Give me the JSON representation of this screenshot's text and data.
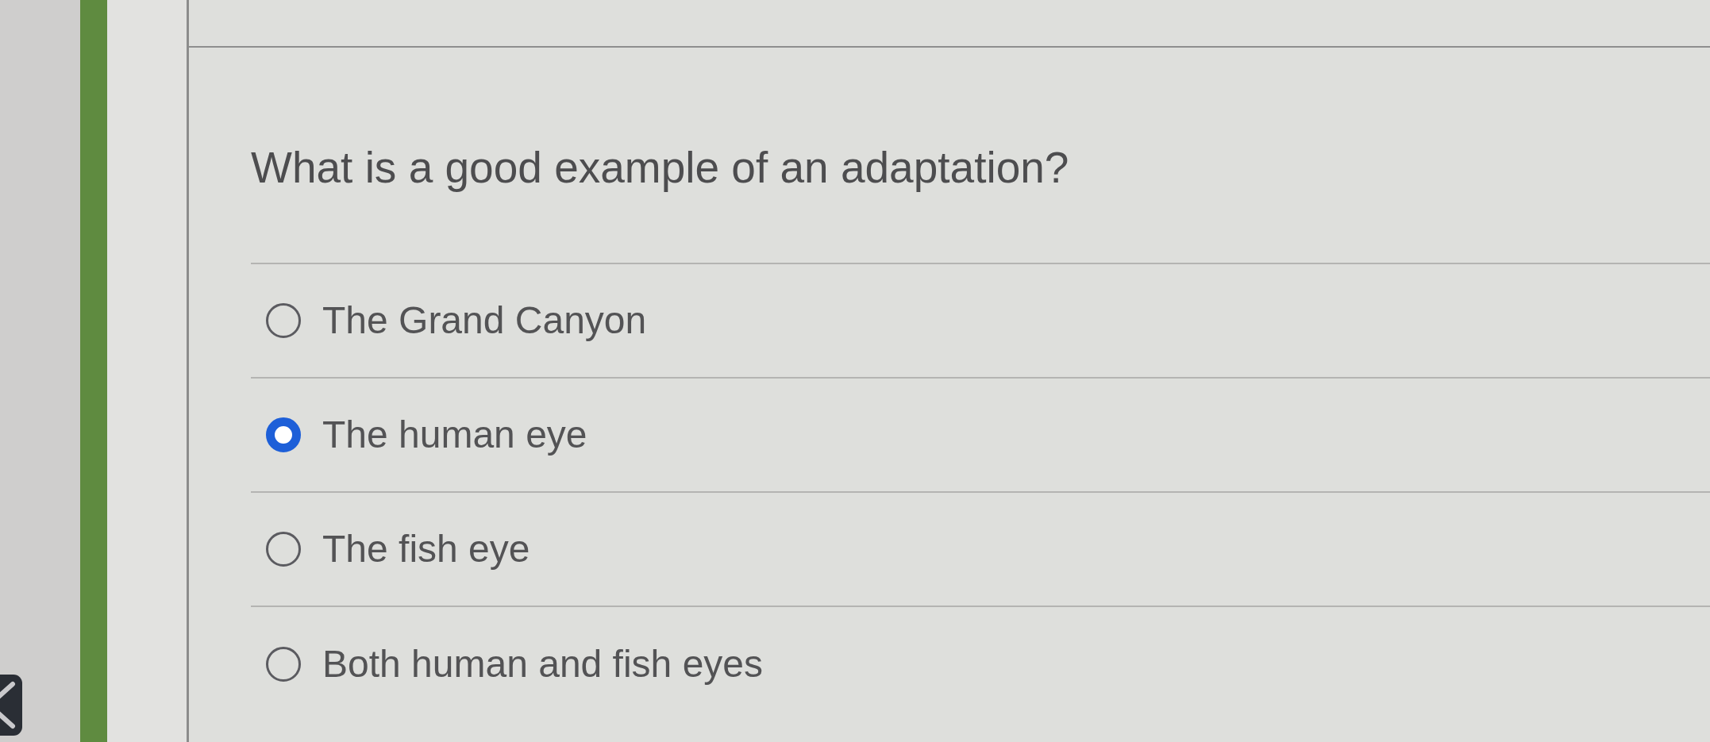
{
  "question": {
    "text": "What is a good example of an adaptation?"
  },
  "options": [
    {
      "label": "The Grand Canyon",
      "selected": false
    },
    {
      "label": "The human eye",
      "selected": true
    },
    {
      "label": "The fish eye",
      "selected": false
    },
    {
      "label": "Both human and fish eyes",
      "selected": false
    }
  ]
}
